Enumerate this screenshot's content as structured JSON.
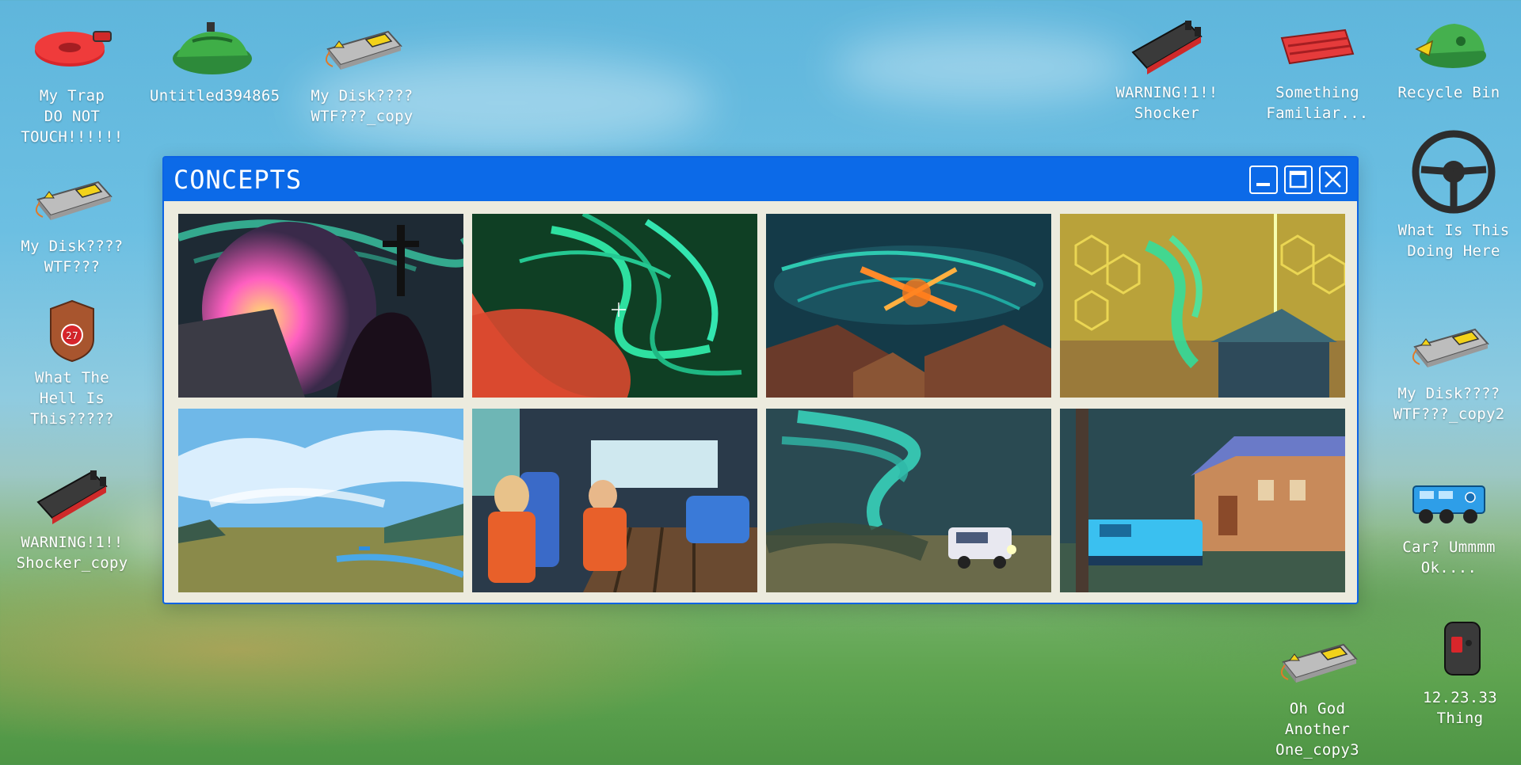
{
  "window": {
    "title": "CONCEPTS",
    "controls": [
      "minimize",
      "maximize",
      "close"
    ]
  },
  "desktop_icons": [
    {
      "label": "My Trap\nDO NOT\nTOUCH!!!!!!",
      "icon": "red-tape-roll-icon"
    },
    {
      "label": "Untitled394865",
      "icon": "green-bag-icon"
    },
    {
      "label": "My Disk????\nWTF???_copy",
      "icon": "hard-drive-icon"
    },
    {
      "label": "My Disk????\nWTF???",
      "icon": "hard-drive-icon"
    },
    {
      "label": "What The\nHell Is\nThis?????",
      "icon": "badge-27-icon"
    },
    {
      "label": "WARNING!1!!\nShocker_copy",
      "icon": "shocker-device-icon"
    },
    {
      "label": "WARNING!1!!\nShocker",
      "icon": "shocker-device-icon"
    },
    {
      "label": "Something\nFamiliar...",
      "icon": "red-strap-icon"
    },
    {
      "label": "Recycle Bin",
      "icon": "recycle-bin-bag-icon"
    },
    {
      "label": "What Is This\nDoing Here",
      "icon": "steering-wheel-icon"
    },
    {
      "label": "My Disk????\nWTF???_copy2",
      "icon": "hard-drive-icon"
    },
    {
      "label": "Car? Ummmm\nOk....",
      "icon": "blue-truck-icon"
    },
    {
      "label": "Oh God Another\nOne_copy3",
      "icon": "hard-drive-icon"
    },
    {
      "label": "12.23.33\nThing",
      "icon": "radio-device-icon"
    }
  ],
  "thumbnails": [
    {
      "icon": "storm-pink-orb-thumbnail"
    },
    {
      "icon": "green-swirl-thumbnail"
    },
    {
      "icon": "fire-tornado-houses-thumbnail"
    },
    {
      "icon": "yellow-hex-tornado-thumbnail"
    },
    {
      "icon": "blue-sky-field-thumbnail"
    },
    {
      "icon": "vehicle-interior-crew-thumbnail"
    },
    {
      "icon": "tornado-truck-thumbnail"
    },
    {
      "icon": "blue-tank-house-thumbnail"
    }
  ],
  "colors": {
    "titlebar": "#0c6ae8",
    "window_bg": "#ecebde",
    "text": "#ffffff"
  }
}
